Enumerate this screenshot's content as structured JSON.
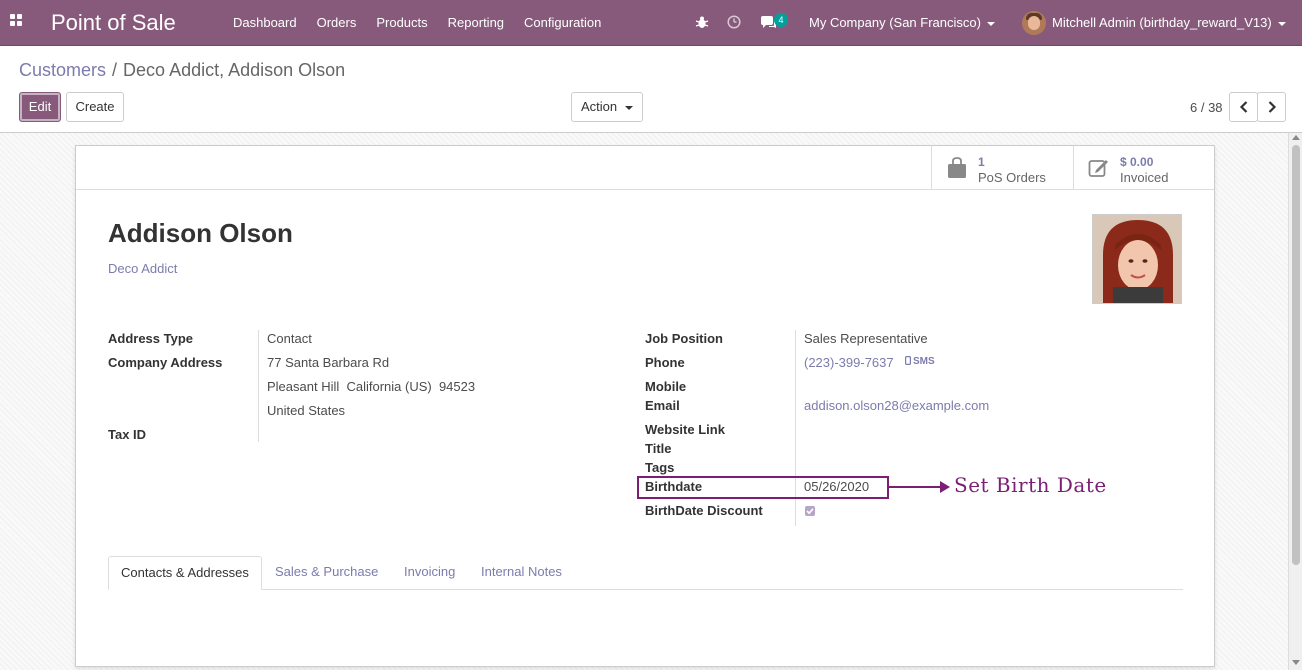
{
  "navbar": {
    "app_title": "Point of Sale",
    "menu": [
      "Dashboard",
      "Orders",
      "Products",
      "Reporting",
      "Configuration"
    ],
    "messages_badge": "4",
    "company": "My Company (San Francisco)",
    "user": "Mitchell Admin (birthday_reward_V13)",
    "icons": [
      "apps-grid-icon",
      "bug-icon",
      "clock-icon",
      "chat-icon"
    ],
    "color": "#875a7b"
  },
  "breadcrumb": {
    "parent": "Customers",
    "separator": "/",
    "current": "Deco Addict, Addison Olson"
  },
  "buttons": {
    "edit": "Edit",
    "create": "Create",
    "action": "Action"
  },
  "pager": {
    "value": "6 / 38"
  },
  "stat_buttons": [
    {
      "number": "1",
      "label": "PoS Orders",
      "icon": "shopping-bag-icon"
    },
    {
      "number": "$ 0.00",
      "label": "Invoiced",
      "icon": "edit-invoice-icon"
    }
  ],
  "partner": {
    "name": "Addison Olson",
    "parent": "Deco Addict"
  },
  "left_fields": {
    "address_type_label": "Address Type",
    "address_type": "Contact",
    "company_address_label": "Company Address",
    "street": "77 Santa Barbara Rd",
    "city_line": "Pleasant Hill  California (US)  94523",
    "country": "United States",
    "tax_id_label": "Tax ID"
  },
  "right_fields": {
    "job_position_label": "Job Position",
    "job_position": "Sales Representative",
    "phone_label": "Phone",
    "phone": "(223)-399-7637",
    "sms": "SMS",
    "mobile_label": "Mobile",
    "email_label": "Email",
    "email": "addison.olson28@example.com",
    "website_label": "Website Link",
    "title_label": "Title",
    "tags_label": "Tags",
    "birthdate_label": "Birthdate",
    "birthdate": "05/26/2020",
    "birthdate_discount_label": "BirthDate Discount",
    "birthdate_discount_checked": true
  },
  "annotation": {
    "text": "Set Birth Date",
    "color": "#7a1f74"
  },
  "tabs": [
    "Contacts & Addresses",
    "Sales & Purchase",
    "Invoicing",
    "Internal Notes"
  ]
}
